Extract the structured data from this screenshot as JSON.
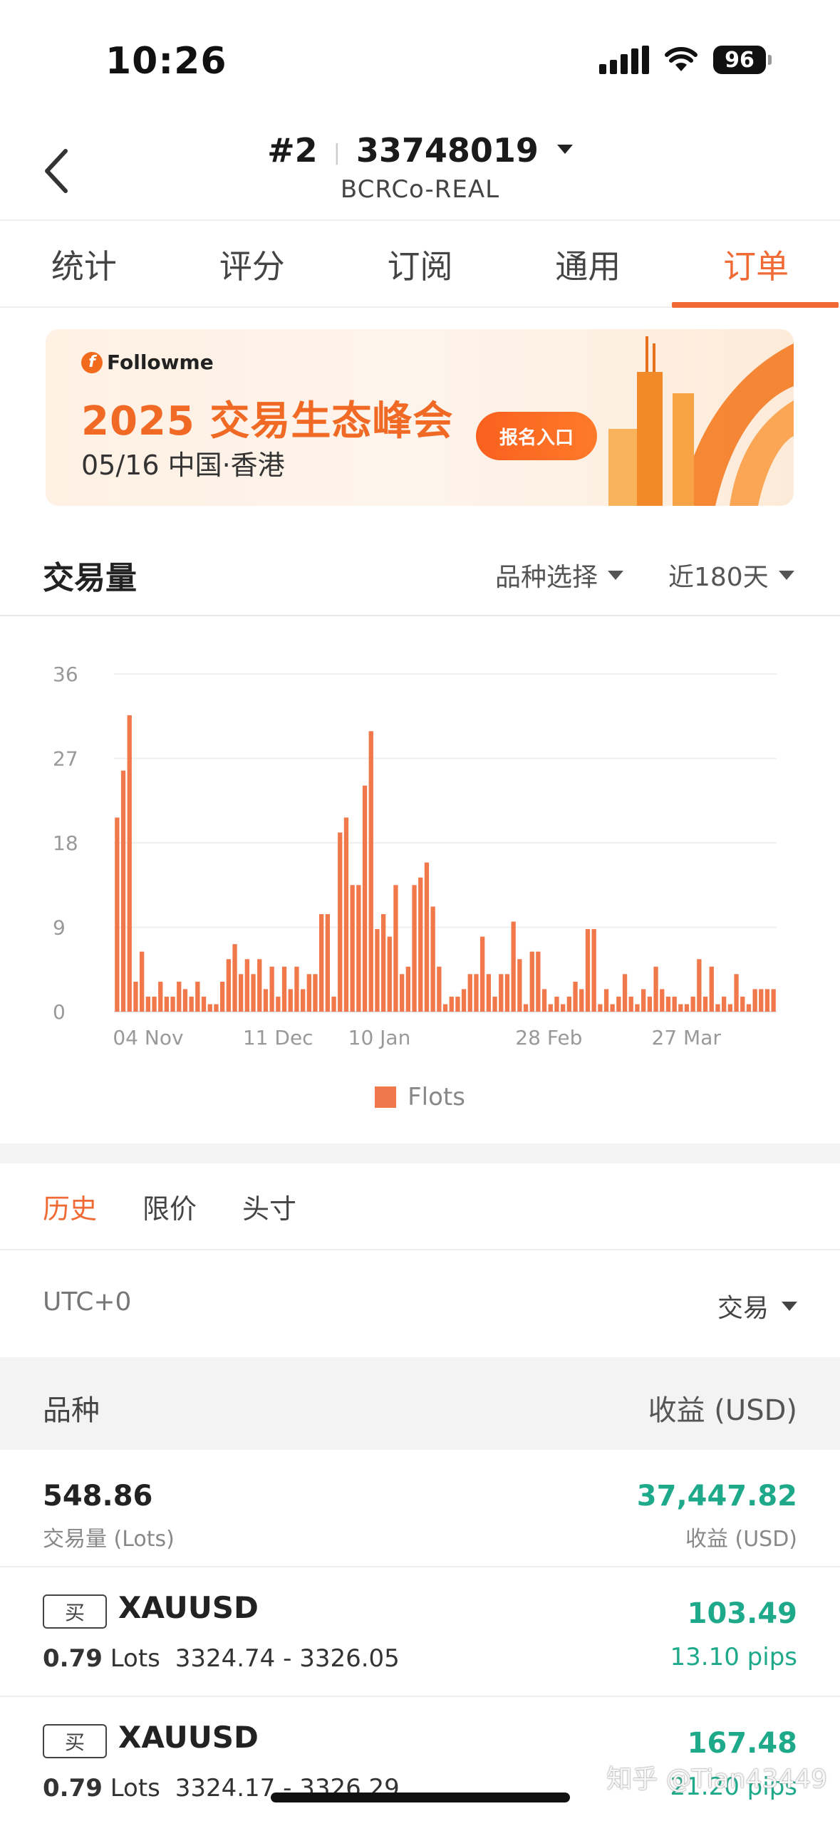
{
  "status_bar": {
    "time": "10:26",
    "battery": "96"
  },
  "header": {
    "account_prefix": "#2",
    "account_id": "33748019",
    "broker": "BCRCo-REAL"
  },
  "tabs": [
    {
      "label": "统计",
      "active": false
    },
    {
      "label": "评分",
      "active": false
    },
    {
      "label": "订阅",
      "active": false
    },
    {
      "label": "通用",
      "active": false
    },
    {
      "label": "订单",
      "active": true
    }
  ],
  "banner": {
    "logo_text": "Followme",
    "logo_letter": "f",
    "title": "2025 交易生态峰会",
    "subtitle": "05/16 中国·香港",
    "button_label": "报名入口"
  },
  "volume": {
    "title": "交易量",
    "symbol_filter": "品种选择",
    "range_filter": "近180天"
  },
  "chart_data": {
    "type": "bar",
    "title": "",
    "xlabel": "",
    "ylabel": "",
    "ylim": [
      0,
      36
    ],
    "yticks": [
      0,
      9,
      18,
      27,
      36
    ],
    "x_tick_labels": [
      "04 Nov",
      "11 Dec",
      "10 Jan",
      "28 Feb",
      "27 Mar"
    ],
    "x_tick_bar_index": [
      0,
      21,
      38,
      65,
      87
    ],
    "grid": true,
    "legend_position": "bottom",
    "series": [
      {
        "name": "Flots",
        "color": "#f0784a",
        "values": [
          20.7,
          25.7,
          31.6,
          3.2,
          6.4,
          1.6,
          1.6,
          3.2,
          1.6,
          1.6,
          3.2,
          2.4,
          1.6,
          3.2,
          1.6,
          0.8,
          0.8,
          3.2,
          5.6,
          7.2,
          4.0,
          5.6,
          4.0,
          5.6,
          2.4,
          4.8,
          1.6,
          4.8,
          2.4,
          4.8,
          2.4,
          4.0,
          4.0,
          10.4,
          10.4,
          1.6,
          19.1,
          20.7,
          13.5,
          13.5,
          24.1,
          29.9,
          8.8,
          10.4,
          8.0,
          13.5,
          4.0,
          4.8,
          13.5,
          14.3,
          15.9,
          11.2,
          4.8,
          0.8,
          1.6,
          1.6,
          2.4,
          4.0,
          4.0,
          8.0,
          4.0,
          1.6,
          4.0,
          4.0,
          9.6,
          5.6,
          0.8,
          6.4,
          6.4,
          2.4,
          0.8,
          1.6,
          0.8,
          1.6,
          3.2,
          2.4,
          8.8,
          8.8,
          0.8,
          2.4,
          0.8,
          1.6,
          4.0,
          1.6,
          0.8,
          2.4,
          1.6,
          4.8,
          2.4,
          1.6,
          1.6,
          0.8,
          0.8,
          1.6,
          5.6,
          1.6,
          4.8,
          0.8,
          1.6,
          0.8,
          4.0,
          1.6,
          0.8,
          2.4,
          2.4,
          2.4,
          2.4
        ]
      }
    ]
  },
  "orders": {
    "subtabs": [
      {
        "label": "历史",
        "active": true
      },
      {
        "label": "限价",
        "active": false
      },
      {
        "label": "头寸",
        "active": false
      }
    ],
    "timezone": "UTC+0",
    "type_filter": "交易",
    "col_symbol": "品种",
    "col_profit": "收益 (USD)",
    "summary": {
      "lots": "548.86",
      "lots_label": "交易量 (Lots)",
      "profit": "37,447.82",
      "profit_label": "收益 (USD)"
    },
    "rows": [
      {
        "side": "买",
        "symbol": "XAUUSD",
        "lots": "0.79",
        "lots_unit": "Lots",
        "prices": "3324.74 - 3326.05",
        "profit": "103.49",
        "pips": "13.10 pips"
      },
      {
        "side": "买",
        "symbol": "XAUUSD",
        "lots": "0.79",
        "lots_unit": "Lots",
        "prices": "3324.17 - 3326.29",
        "profit": "167.48",
        "pips": "21.20 pips"
      }
    ]
  },
  "watermark": "知乎 @Tian43449"
}
